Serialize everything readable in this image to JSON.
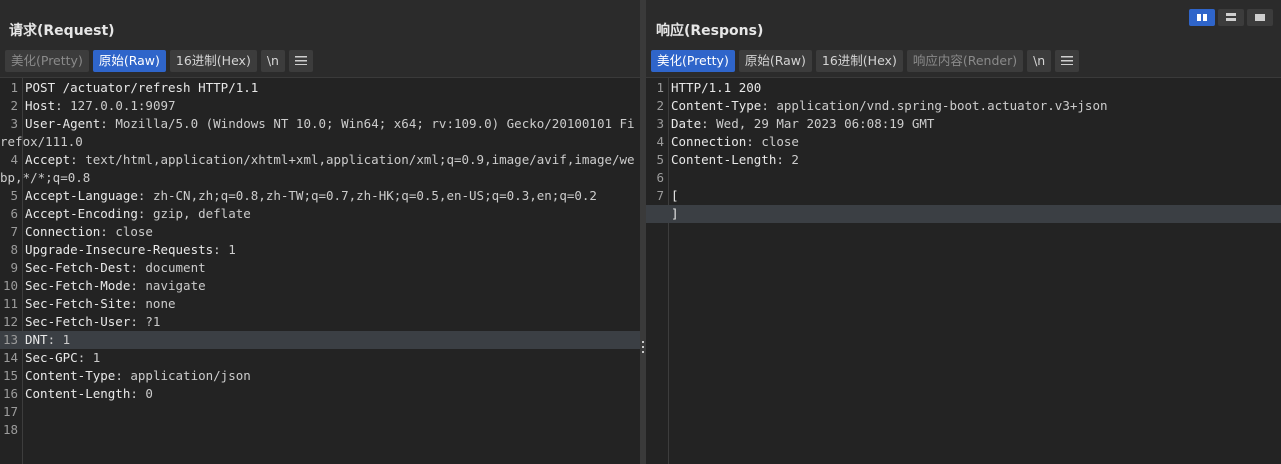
{
  "request": {
    "title": "请求(Request)",
    "tabs": [
      {
        "label": "美化(Pretty)",
        "state": "dim"
      },
      {
        "label": "原始(Raw)",
        "state": "active"
      },
      {
        "label": "16进制(Hex)",
        "state": "normal"
      }
    ],
    "newline_label": "\\n",
    "menu_icon": "hamburger-icon",
    "lines": [
      {
        "n": "1",
        "key": "POST /actuator/refresh HTTP/1.1",
        "val": ""
      },
      {
        "n": "2",
        "key": "Host",
        "val": ": 127.0.0.1:9097"
      },
      {
        "n": "3",
        "key": "User-Agent",
        "val": ": Mozilla/5.0 (Windows NT 10.0; Win64; x64; rv:109.0) Gecko/20100101 Firefox/111.0"
      },
      {
        "n": "4",
        "key": "Accept",
        "val": ": text/html,application/xhtml+xml,application/xml;q=0.9,image/avif,image/webp,*/*;q=0.8"
      },
      {
        "n": "5",
        "key": "Accept-Language",
        "val": ": zh-CN,zh;q=0.8,zh-TW;q=0.7,zh-HK;q=0.5,en-US;q=0.3,en;q=0.2"
      },
      {
        "n": "6",
        "key": "Accept-Encoding",
        "val": ": gzip, deflate"
      },
      {
        "n": "7",
        "key": "Connection",
        "val": ": close"
      },
      {
        "n": "8",
        "key": "Upgrade-Insecure-Requests",
        "val": ": 1"
      },
      {
        "n": "9",
        "key": "Sec-Fetch-Dest",
        "val": ": document"
      },
      {
        "n": "10",
        "key": "Sec-Fetch-Mode",
        "val": ": navigate"
      },
      {
        "n": "11",
        "key": "Sec-Fetch-Site",
        "val": ": none"
      },
      {
        "n": "12",
        "key": "Sec-Fetch-User",
        "val": ": ?1"
      },
      {
        "n": "13",
        "key": "DNT",
        "val": ": 1",
        "highlight": true
      },
      {
        "n": "14",
        "key": "Sec-GPC",
        "val": ": 1"
      },
      {
        "n": "15",
        "key": "Content-Type",
        "val": ": application/json"
      },
      {
        "n": "16",
        "key": "Content-Length",
        "val": ": 0"
      },
      {
        "n": "17",
        "key": "",
        "val": ""
      },
      {
        "n": "18",
        "key": "",
        "val": ""
      }
    ]
  },
  "response": {
    "title": "响应(Respons)",
    "tabs": [
      {
        "label": "美化(Pretty)",
        "state": "active"
      },
      {
        "label": "原始(Raw)",
        "state": "normal"
      },
      {
        "label": "16进制(Hex)",
        "state": "normal"
      },
      {
        "label": "响应内容(Render)",
        "state": "dim"
      }
    ],
    "newline_label": "\\n",
    "menu_icon": "hamburger-icon",
    "lines": [
      {
        "n": "1",
        "key": "HTTP/1.1 200",
        "val": ""
      },
      {
        "n": "2",
        "key": "Content-Type",
        "val": ": application/vnd.spring-boot.actuator.v3+json"
      },
      {
        "n": "3",
        "key": "Date",
        "val": ": Wed, 29 Mar 2023 06:08:19 GMT"
      },
      {
        "n": "4",
        "key": "Connection",
        "val": ": close"
      },
      {
        "n": "5",
        "key": "Content-Length",
        "val": ": 2"
      },
      {
        "n": "6",
        "key": "",
        "val": ""
      },
      {
        "n": "7",
        "key": "[",
        "val": ""
      },
      {
        "n": "",
        "key": "]",
        "val": "",
        "highlight": true
      }
    ]
  },
  "layout_buttons": [
    {
      "name": "layout-side-by-side-button",
      "state": "active"
    },
    {
      "name": "layout-top-bottom-button",
      "state": "normal"
    },
    {
      "name": "layout-single-button",
      "state": "normal"
    }
  ],
  "colors": {
    "accent": "#2f65ca",
    "background": "#2b2b2b",
    "editor": "#232323",
    "highlight_line": "#3b3f44"
  }
}
